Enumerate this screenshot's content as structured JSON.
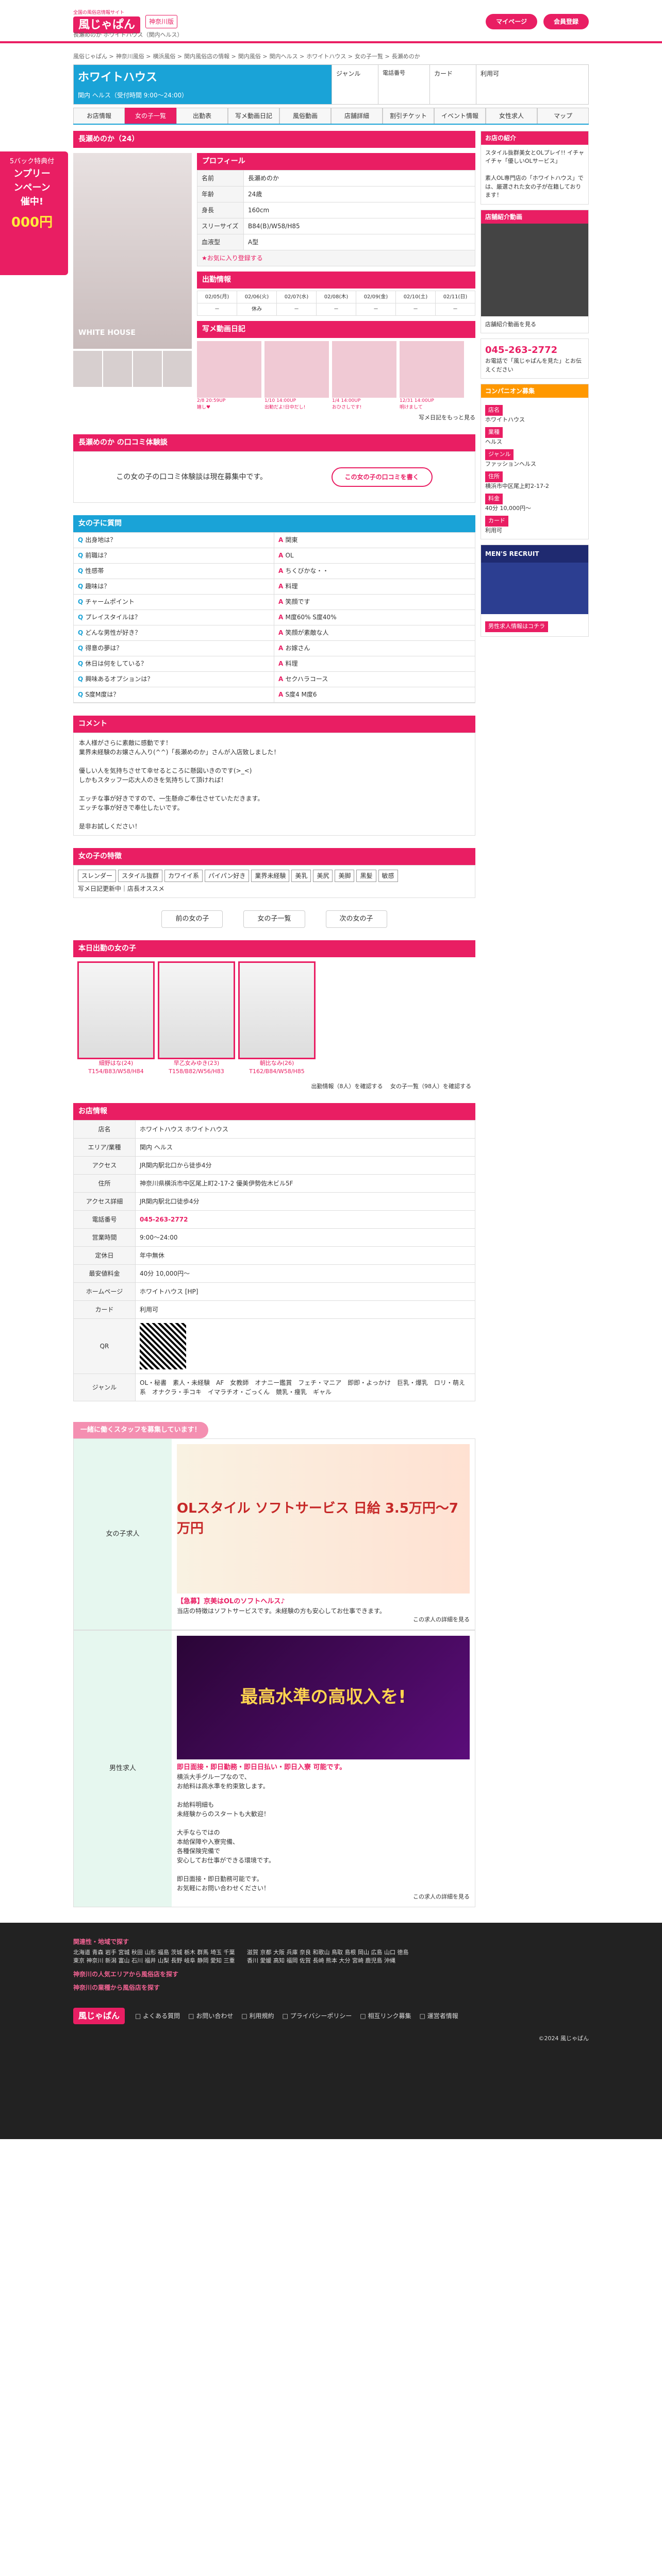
{
  "header": {
    "logo": "風じゃぱん",
    "logo_sub": "全国の風俗店情報サイト",
    "area": "神奈川版",
    "sub": "長瀬めのか ホワイトハウス（関内ヘルス）",
    "mypage": "マイページ",
    "register": "会員登録"
  },
  "breadcrumb": [
    "風俗じゃぱん",
    "神奈川風俗",
    "横浜風俗",
    "関内風俗店の情報",
    "関内風俗",
    "関内ヘルス",
    "ホワイトハウス",
    "女の子一覧",
    "長瀬めのか"
  ],
  "shop": {
    "name": "ホワイトハウス",
    "sub": "関内 ヘルス（受付時間 9:00〜24:00）",
    "genre": "ジャンル",
    "phone_label": "電話番号",
    "card": "カード",
    "card_value": "利用可"
  },
  "tabs": [
    "お店情報",
    "女の子一覧",
    "出勤表",
    "写メ動画日記",
    "風俗動画",
    "店舗詳細",
    "割引チケット",
    "イベント情報",
    "女性求人",
    "マップ"
  ],
  "float_banner": {
    "line1": "5バック特典付",
    "line2": "ンプリー\nンペーン\n催中!",
    "amount": "000円"
  },
  "girl": {
    "title": "長瀬めのか（24）",
    "photo_caption": "WHITE HOUSE",
    "profile_head": "プロフィール",
    "profile": [
      {
        "k": "名前",
        "v": "長瀬めのか"
      },
      {
        "k": "年齢",
        "v": "24歳"
      },
      {
        "k": "身長",
        "v": "160cm"
      },
      {
        "k": "スリーサイズ",
        "v": "B84(B)/W58/H85"
      },
      {
        "k": "血液型",
        "v": "A型"
      }
    ],
    "fav": "★お気に入り登録する",
    "sched_head": "出勤情報",
    "sched_days": [
      "02/05(月)",
      "02/06(火)",
      "02/07(水)",
      "02/08(木)",
      "02/09(金)",
      "02/10(土)",
      "02/11(日)"
    ],
    "sched_vals": [
      "－",
      "休み",
      "－",
      "－",
      "－",
      "－",
      "－"
    ],
    "diary_head": "写メ動画日記",
    "diaries": [
      {
        "t": "2/8 20:59UP",
        "d": "嬉し♥"
      },
      {
        "t": "1/10 14:00UP",
        "d": "出勤だよ!日中だし!"
      },
      {
        "t": "1/4 14:00UP",
        "d": "おひさしです!"
      },
      {
        "t": "12/31 14:00UP",
        "d": "明けまして"
      }
    ],
    "diary_more": "写メ日記をもっと見る"
  },
  "review": {
    "head": "長瀬めのか の口コミ体験談",
    "text": "この女の子の口コミ体験談は現在募集中です。",
    "btn": "この女の子の口コミを書く"
  },
  "qa": {
    "head": "女の子に質問",
    "items": [
      {
        "q": "出身地は？",
        "a": "関東"
      },
      {
        "q": "前職は？",
        "a": "OL"
      },
      {
        "q": "性感帯",
        "a": "ちくびかな・・"
      },
      {
        "q": "趣味は？",
        "a": "料理"
      },
      {
        "q": "チャームポイント",
        "a": "笑顔です"
      },
      {
        "q": "プレイスタイルは？",
        "a": "M度60% S度40%"
      },
      {
        "q": "どんな男性が好き？",
        "a": "笑顔が素敵な人"
      },
      {
        "q": "得意の夢は？",
        "a": "お嫁さん"
      },
      {
        "q": "休日は何をしている？",
        "a": "料理"
      },
      {
        "q": "興味あるオプションは？",
        "a": "セクハラコース"
      },
      {
        "q": "S度M度は？",
        "a": "S度4 M度6"
      }
    ]
  },
  "comment": {
    "head": "コメント",
    "text": "本人様がさらに素敵に感動です！\n業界未経験のお嬢さん入り(^^)「長瀬めのか」さんが入店致しました！\n\n優しい人を気持ちさせて幸せるところに懸図いきのです(>_<)\nしかもスタッフ一応大人のきを気持ちして頂ければ！\n\nエッチな事が好きですので、一生懸命ご奉仕させていただきます。\nエッチな事が好きで奉仕したいです。\n\n是非お試しください！"
  },
  "features": {
    "head": "女の子の特徴",
    "tags": [
      "スレンダー",
      "スタイル抜群",
      "カワイイ系",
      "パイパン好き",
      "業界未経験",
      "美乳",
      "美尻",
      "美脚",
      "黒髪",
      "敏感"
    ],
    "links": "写メ日記更新中｜店長オススメ"
  },
  "pager": {
    "prev": "前の女の子",
    "list": "女の子一覧",
    "next": "次の女の子"
  },
  "today": {
    "head": "本日出勤の女の子",
    "girls": [
      {
        "name": "細野はな(24)",
        "info": "T154/B83/W58/H84"
      },
      {
        "name": "早乙女みゆき(23)",
        "info": "T158/B82/W56/H83"
      },
      {
        "name": "朝比なみ(26)",
        "info": "T162/B84/W58/H85"
      }
    ],
    "more1": "出勤情報（8人）を確認する",
    "more2": "女の子一覧（98人）を確認する"
  },
  "info": {
    "head": "お店情報",
    "rows": [
      {
        "k": "店名",
        "v": "ホワイトハウス ホワイトハウス"
      },
      {
        "k": "エリア/業種",
        "v": "関内 ヘルス"
      },
      {
        "k": "アクセス",
        "v": "JR関内駅北口から徒歩4分"
      },
      {
        "k": "住所",
        "v": "神奈川県横浜市中区尾上町2-17-2 優美伊勢佐木ビル5F"
      },
      {
        "k": "アクセス詳細",
        "v": "JR関内駅北口徒歩4分"
      },
      {
        "k": "電話番号",
        "v": "045-263-2772"
      },
      {
        "k": "営業時間",
        "v": "9:00〜24:00"
      },
      {
        "k": "定休日",
        "v": "年中無休"
      },
      {
        "k": "最安値料金",
        "v": "40分 10,000円〜"
      },
      {
        "k": "ホームページ",
        "v": "ホワイトハウス [HP]"
      },
      {
        "k": "カード",
        "v": "利用可"
      },
      {
        "k": "QR",
        "v": ""
      },
      {
        "k": "ジャンル",
        "v": "OL・秘書　素人・未経験　AF　女教師　オナニー鑑賞　フェチ・マニア　即即・よっかけ　巨乳・爆乳　ロリ・萌え系　オナクラ・手コキ　イマラチオ・ごっくん　競乳・痩乳　ギャル"
      }
    ]
  },
  "recruit": {
    "head": "一緒に働くスタッフを募集しています！",
    "female_label": "女の子求人",
    "male_label": "男性求人",
    "banner1": "OLスタイル ソフトサービス 日給 3.5万円〜7万円",
    "title1": "【急募】京美はOLのソフトヘルス♪",
    "text1": "当店の特徴はソフトサービスです。未経験の方も安心してお仕事できます。",
    "more1": "この求人の詳細を見る",
    "banner2": "最高水準の高収入を!",
    "title2": "即日面接・即日勤務・即日日払い・即日入寮 可能です。",
    "text2": "横浜大手グループなので、\nお給料は高水準を約束致します。\n\nお給料明細も\n未経験からのスタートも大歓迎！\n\n大手ならではの\n本給保障や入寮完備、\n各種保険完備で\n安心してお仕事ができる環境です。\n\n即日面接・即日勤務可能です。\nお気軽にお問い合わせください！",
    "more2": "この求人の詳細を見る"
  },
  "sidebar": {
    "info_head": "お店の紹介",
    "info_text": "スタイル抜群美女とOLプレイ!! イチャイチャ「優しいOLサービス」\n\n素人OL専門店の「ホワイトハウス」では、厳選された女の子が在籍しております！",
    "video_head": "店舗紹介動画",
    "video_link": "店舗紹介動画を見る",
    "tel": "045-263-2772",
    "tel_note": "お電話で「風じゃぱんを見た」とお伝えください",
    "concierge": "コンパニオン募集",
    "nav": [
      {
        "k": "店名",
        "v": "ホワイトハウス"
      },
      {
        "k": "業種",
        "v": "ヘルス"
      },
      {
        "k": "ジャンル",
        "v": "ファッションヘルス"
      },
      {
        "k": "住所",
        "v": "横浜市中区尾上町2-17-2"
      },
      {
        "k": "料金",
        "v": "40分 10,000円〜"
      },
      {
        "k": "カード",
        "v": "利用可"
      }
    ],
    "mens": "MEN'S RECRUIT",
    "mens_btn": "男性求人情報はコチラ"
  },
  "footer": {
    "head1": "関連性・地域で探す",
    "links": [
      "北海道",
      "青森",
      "岩手",
      "宮城",
      "秋田",
      "山形",
      "福島",
      "茨城",
      "栃木",
      "群馬",
      "埼玉",
      "千葉",
      "東京",
      "神奈川",
      "新潟",
      "富山",
      "石川",
      "福井",
      "山梨",
      "長野",
      "岐阜",
      "静岡",
      "愛知",
      "三重",
      "滋賀",
      "京都",
      "大阪",
      "兵庫",
      "奈良",
      "和歌山",
      "鳥取",
      "島根",
      "岡山",
      "広島",
      "山口",
      "徳島",
      "香川",
      "愛媛",
      "高知",
      "福岡",
      "佐賀",
      "長崎",
      "熊本",
      "大分",
      "宮崎",
      "鹿児島",
      "沖縄"
    ],
    "head2": "神奈川の人気エリアから風俗店を探す",
    "head3": "神奈川の業種から風俗店を探す",
    "bottom": [
      "よくある質問",
      "お問い合わせ",
      "利用規約",
      "プライバシーポリシー",
      "相互リンク募集",
      "運営者情報"
    ],
    "copyright": "©2024 風じゃぱん"
  }
}
